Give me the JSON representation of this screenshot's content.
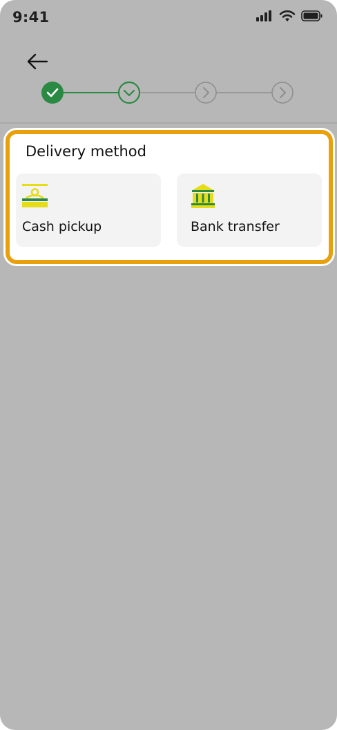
{
  "status_bar": {
    "time": "9:41",
    "icons": [
      "signal-icon",
      "wifi-icon",
      "battery-icon"
    ]
  },
  "header": {
    "back_icon": "arrow-left-icon",
    "stepper": {
      "total_steps": 4,
      "completed_steps": 1,
      "current_step": 2,
      "colors": {
        "completed": "#2a8a43",
        "current": "#2a8a43",
        "upcoming": "#8e8e8e"
      }
    }
  },
  "delivery": {
    "title": "Delivery method",
    "highlight_color": "#e8a00c",
    "options": [
      {
        "label": "Cash pickup",
        "icon": "cash-pickup-icon"
      },
      {
        "label": "Bank transfer",
        "icon": "bank-icon"
      }
    ]
  },
  "colors": {
    "icon_yellow": "#e6dc18",
    "icon_green": "#2a8a43"
  }
}
